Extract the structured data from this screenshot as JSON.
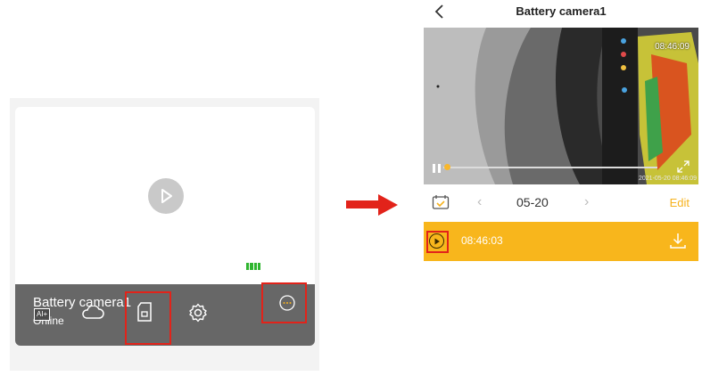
{
  "device_card": {
    "name": "Battery camera1",
    "status": "Online",
    "ai_badge": "AI+",
    "actions": [
      {
        "name": "cloud-storage-button",
        "icon": "cloud-icon"
      },
      {
        "name": "sd-card-playback-button",
        "icon": "sd-card-icon"
      },
      {
        "name": "settings-button",
        "icon": "gear-icon"
      },
      {
        "name": "more-button",
        "icon": "more-dots-icon"
      }
    ],
    "highlight_color": "#e2231a"
  },
  "arrow": {
    "color": "#e2231a"
  },
  "playback": {
    "title": "Battery camera1",
    "video": {
      "time_overlay": "08:46:09",
      "date_stamp": "2021-05-20 08:46:09"
    },
    "date_bar": {
      "date": "05-20",
      "prev_label": "‹",
      "next_label": "›",
      "edit_label": "Edit"
    },
    "recordings": [
      {
        "time": "08:46:03"
      }
    ],
    "accent_color": "#f8b61c"
  }
}
